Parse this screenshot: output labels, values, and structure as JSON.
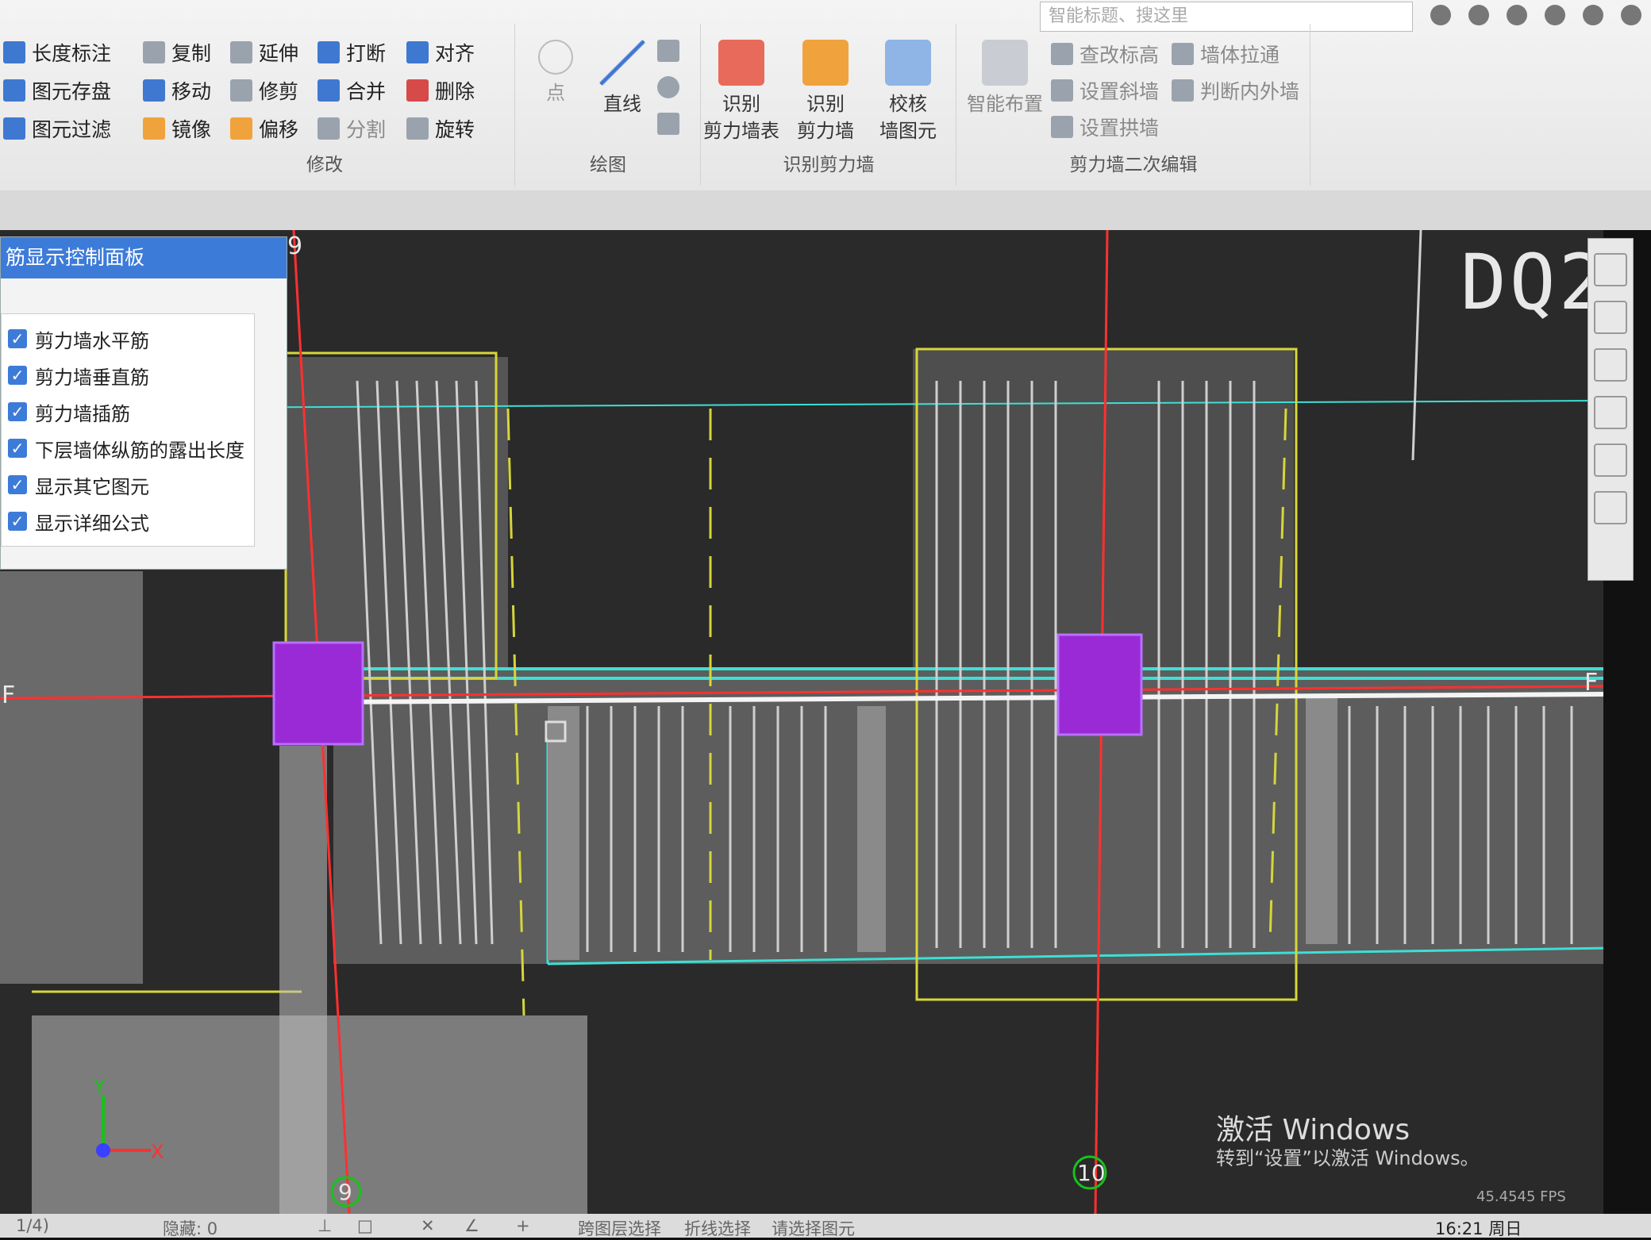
{
  "ribbon": {
    "search_placeholder": "智能标题、搜这里",
    "group_modify": {
      "label": "修改",
      "items": [
        "长度标注",
        "图元存盘",
        "图元过滤",
        "复制",
        "移动",
        "镜像",
        "延伸",
        "修剪",
        "偏移",
        "打断",
        "合并",
        "分割",
        "对齐",
        "删除",
        "旋转"
      ]
    },
    "group_draw": {
      "label": "绘图",
      "point": "点",
      "line": "直线"
    },
    "group_identify": {
      "label": "识别剪力墙",
      "btn1": "识别\n剪力墙表",
      "btn2": "识别\n剪力墙",
      "btn3": "校核\n墙图元"
    },
    "group_edit2": {
      "label": "剪力墙二次编辑",
      "smart": "智能布置",
      "items": [
        "查改标高",
        "设置斜墙",
        "设置拱墙",
        "墙体拉通",
        "判断内外墙"
      ]
    }
  },
  "panel": {
    "title": "筋显示控制面板",
    "options": [
      "剪力墙水平筋",
      "剪力墙垂直筋",
      "剪力墙插筋",
      "下层墙体纵筋的露出长度",
      "显示其它图元",
      "显示详细公式"
    ]
  },
  "canvas": {
    "drawing_label": "DQ2",
    "axis_labels": {
      "top9": "9",
      "bottom9": "9",
      "bottom10": "10",
      "leftF": "F",
      "rightF": "F"
    },
    "ucs": {
      "y": "Y",
      "x": "X"
    }
  },
  "watermark": {
    "line1": "激活 Windows",
    "line2": "转到“设置”以激活 Windows。"
  },
  "fps": "45.4545 FPS",
  "status": {
    "page": "1/4)",
    "hidden": "隐藏: 0",
    "cross_layer": "跨图层选择",
    "polyline_select": "折线选择",
    "prompt": "请选择图元",
    "clock": "16:21 周日"
  },
  "colors": {
    "ribbon_blue": "#3f78d1",
    "panel_title": "#3d7bd9",
    "wall_cyan": "#3ce0d6",
    "rebar_yellow": "#d6d63a",
    "axis_red": "#ff3030",
    "column_purple": "#9a2ad6"
  }
}
